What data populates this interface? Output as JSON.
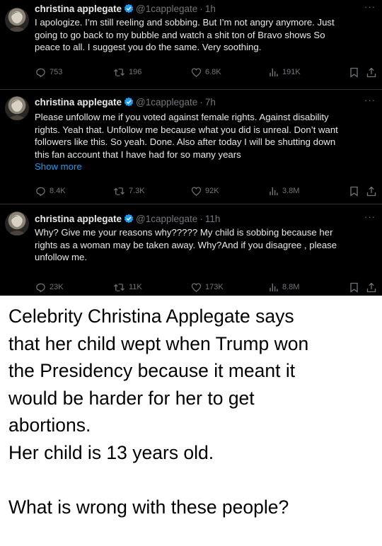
{
  "tweets": [
    {
      "name": "christina applegate",
      "handle": "@1capplegate",
      "sep": "·",
      "time": "1h",
      "more": "···",
      "lines": [
        "I apologize. I’m still reeling and sobbing. But I’m not angry anymore. Just",
        "going to go back to my bubble and watch a shit ton of Bravo shows  So",
        "peace to all. I suggest you do the same. Very soothing."
      ],
      "show_more": "",
      "replies": "753",
      "reposts": "196",
      "likes": "6.8K",
      "views": "191K"
    },
    {
      "name": "christina applegate",
      "handle": "@1capplegate",
      "sep": "·",
      "time": "7h",
      "more": "···",
      "lines": [
        "Please unfollow me if you voted against female rights. Against disability",
        "rights. Yeah that. Unfollow me because what you did is unreal. Don’t want",
        "followers like this. So yeah. Done. Also after today I will be shutting down",
        "this fan account that I have had for so many years"
      ],
      "show_more": "Show more",
      "replies": "8.4K",
      "reposts": "7.3K",
      "likes": "92K",
      "views": "3.8M"
    },
    {
      "name": "christina applegate",
      "handle": "@1capplegate",
      "sep": "·",
      "time": "11h",
      "more": "···",
      "lines": [
        "Why? Give me your reasons why????? My child is sobbing because her",
        "rights as a woman may be taken away. Why?And if you disagree , please",
        "unfollow me."
      ],
      "show_more": "",
      "replies": "23K",
      "reposts": "11K",
      "likes": "173K",
      "views": "8.8M"
    }
  ],
  "icons": {
    "reply": "reply-icon",
    "repost": "repost-icon",
    "like": "heart-icon",
    "views": "views-chart-icon",
    "bookmark": "bookmark-icon",
    "share": "share-icon",
    "verified": "verified-badge-icon"
  },
  "colors": {
    "tweet_bg": "#000000",
    "text": "#e7e9ea",
    "muted": "#71767b",
    "link": "#1d9bf0",
    "verified": "#1d9bf0",
    "caption_text": "#000000",
    "caption_bg": "#ffffff"
  },
  "caption": [
    "Celebrity Christina Applegate says",
    "that her child wept when Trump won",
    "the Presidency because it meant it",
    "would be harder for her to get",
    "abortions.",
    "Her child is 13 years old.",
    "",
    "What is wrong with these people?"
  ]
}
